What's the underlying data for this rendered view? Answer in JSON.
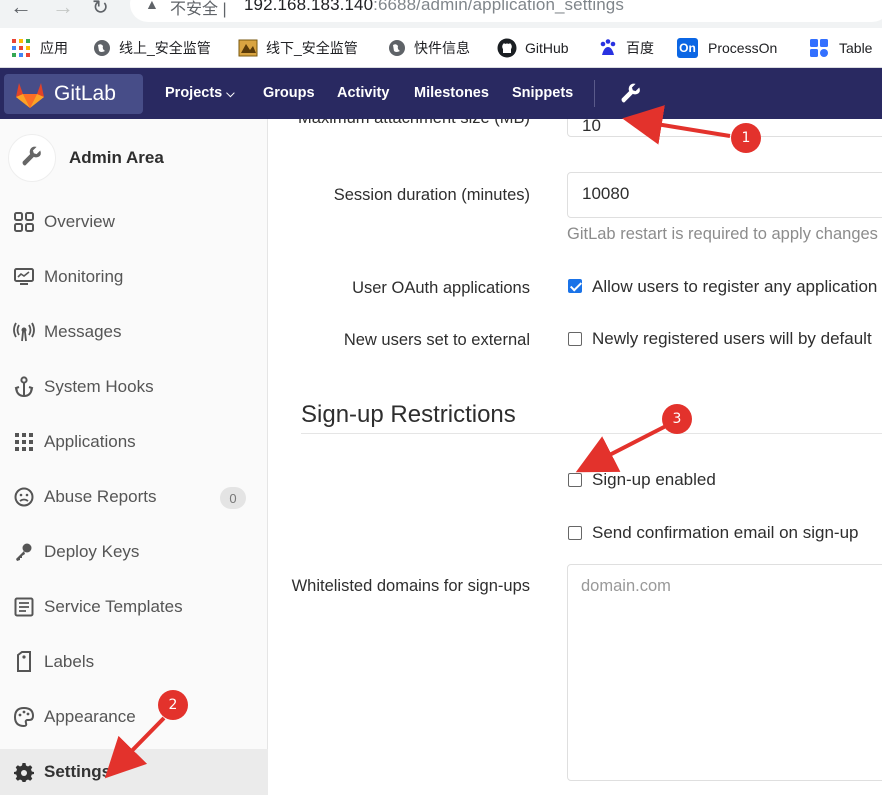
{
  "browser": {
    "insecure_label": "不安全",
    "url_main": "192.168.183.140",
    "url_rest": ":6688/admin/application_settings",
    "bookmarks": [
      {
        "label": "应用",
        "icon": "apps-grid-icon"
      },
      {
        "label": "线上_安全监管",
        "icon": "globe-icon"
      },
      {
        "label": "线下_安全监管",
        "icon": "page-icon"
      },
      {
        "label": "快件信息",
        "icon": "globe-icon"
      },
      {
        "label": "GitHub",
        "icon": "github-icon"
      },
      {
        "label": "百度",
        "icon": "baidu-icon"
      },
      {
        "label": "ProcessOn",
        "icon": "processon-icon"
      },
      {
        "label": "Table",
        "icon": "table-icon"
      }
    ]
  },
  "header": {
    "brand": "GitLab",
    "nav": [
      "Projects",
      "Groups",
      "Activity",
      "Milestones",
      "Snippets"
    ],
    "admin_icon": "wrench-icon"
  },
  "sidebar": {
    "title": "Admin Area",
    "items": [
      {
        "label": "Overview",
        "icon": "overview-icon"
      },
      {
        "label": "Monitoring",
        "icon": "monitor-icon"
      },
      {
        "label": "Messages",
        "icon": "broadcast-icon"
      },
      {
        "label": "System Hooks",
        "icon": "anchor-icon"
      },
      {
        "label": "Applications",
        "icon": "apps-grid-icon"
      },
      {
        "label": "Abuse Reports",
        "icon": "frown-icon",
        "count": "0"
      },
      {
        "label": "Deploy Keys",
        "icon": "key-icon"
      },
      {
        "label": "Service Templates",
        "icon": "template-icon"
      },
      {
        "label": "Labels",
        "icon": "label-icon"
      },
      {
        "label": "Appearance",
        "icon": "palette-icon"
      },
      {
        "label": "Settings",
        "icon": "gear-icon",
        "active": true
      }
    ]
  },
  "settings": {
    "max_attachment_label": "Maximum attachment size (MB)",
    "max_attachment_value": "10",
    "session_label": "Session duration (minutes)",
    "session_value": "10080",
    "session_help": "GitLab restart is required to apply changes",
    "oauth_label": "User OAuth applications",
    "oauth_checkbox": "Allow users to register any application",
    "oauth_checked": true,
    "external_label": "New users set to external",
    "external_checkbox": "Newly registered users will by default",
    "external_checked": false,
    "signup_section_title": "Sign-up Restrictions",
    "signup_enabled_label": "Sign-up enabled",
    "signup_enabled_checked": false,
    "confirm_email_label": "Send confirmation email on sign-up",
    "confirm_email_checked": false,
    "whitelist_label": "Whitelisted domains for sign-ups",
    "whitelist_placeholder": "domain.com"
  },
  "annotations": {
    "markers": [
      "1",
      "2",
      "3"
    ],
    "color": "#e3322c"
  }
}
